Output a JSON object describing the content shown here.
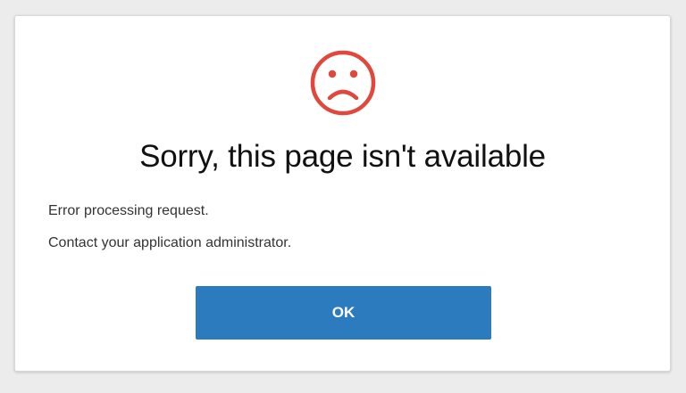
{
  "dialog": {
    "icon": "sad-face-icon",
    "icon_color": "#e2473b",
    "title": "Sorry, this page isn't available",
    "messages": [
      "Error processing request.",
      "Contact your application administrator."
    ],
    "ok_label": "OK",
    "button_color": "#2c7bbf"
  }
}
